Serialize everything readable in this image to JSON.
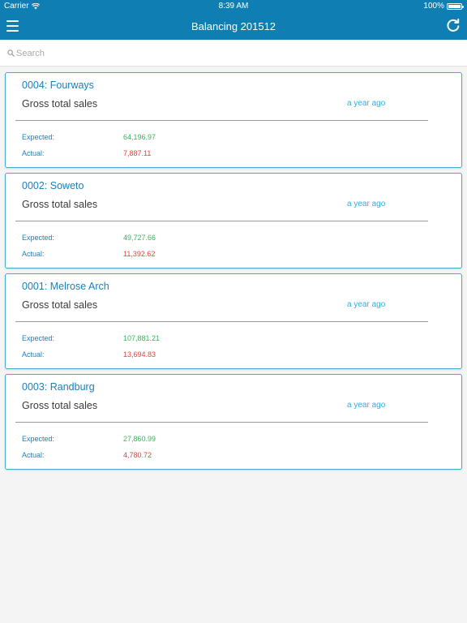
{
  "status_bar": {
    "carrier": "Carrier",
    "time": "8:39 AM",
    "battery": "100%"
  },
  "nav": {
    "title": "Balancing 201512",
    "menu_icon": "hamburger-icon",
    "refresh_icon": "refresh-icon"
  },
  "search": {
    "placeholder": "Search",
    "value": ""
  },
  "colors": {
    "brand": "#0f7fb3",
    "card_border": "#49a9d3",
    "expected": "#35b85a",
    "actual": "#e2443c",
    "time_ago": "#2fb0dc"
  },
  "cards": [
    {
      "name": "0004: Fourways",
      "metric": "Gross total sales",
      "time_ago": "a year ago",
      "expected_label": "Expected:",
      "expected": "64,196.97",
      "actual_label": "Actual:",
      "actual": "7,887.11"
    },
    {
      "name": "0002: Soweto",
      "metric": "Gross total sales",
      "time_ago": "a year ago",
      "expected_label": "Expected:",
      "expected": "49,727.66",
      "actual_label": "Actual:",
      "actual": "11,392.62"
    },
    {
      "name": "0001: Melrose Arch",
      "metric": "Gross total sales",
      "time_ago": "a year ago",
      "expected_label": "Expected:",
      "expected": "107,881.21",
      "actual_label": "Actual:",
      "actual": "13,694.83"
    },
    {
      "name": "0003: Randburg",
      "metric": "Gross total sales",
      "time_ago": "a year ago",
      "expected_label": "Expected:",
      "expected": "27,860.99",
      "actual_label": "Actual:",
      "actual": "4,780.72"
    }
  ]
}
